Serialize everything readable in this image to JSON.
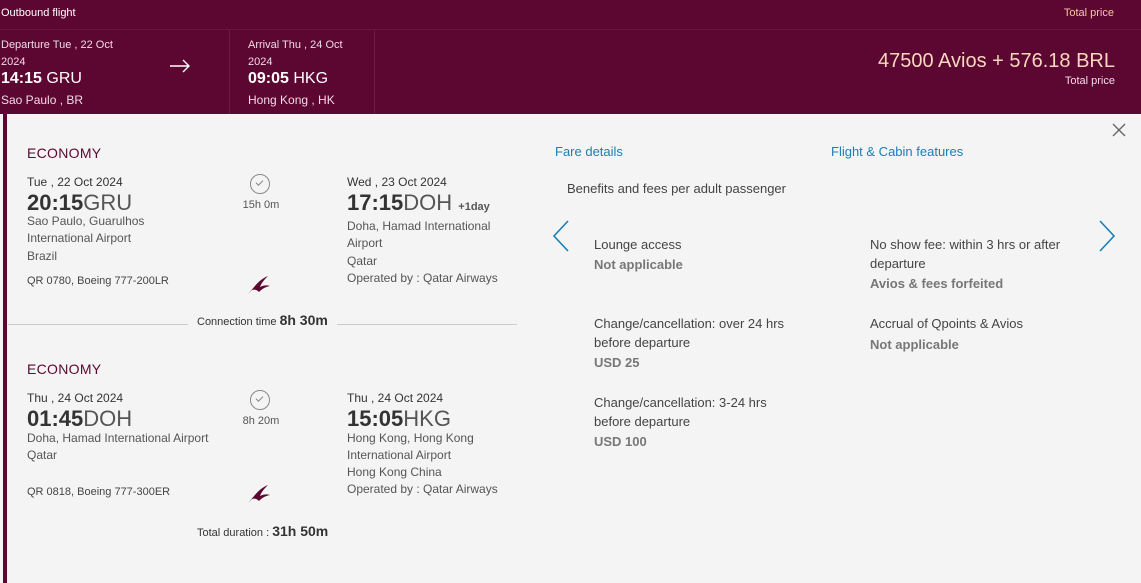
{
  "header": {
    "title": "Outbound flight",
    "total_price_label": "Total price",
    "departure": {
      "label": "Departure Tue , 22 Oct 2024",
      "time": "14:15",
      "code": "GRU",
      "city": "Sao Paulo , BR"
    },
    "arrival": {
      "label": "Arrival Thu , 24 Oct 2024",
      "time": "09:05",
      "code": "HKG",
      "city": "Hong Kong , HK"
    },
    "price": "47500 Avios + 576.18 BRL",
    "price_sub": "Total price",
    "arrow_icon": "arrow-right-icon"
  },
  "segments": [
    {
      "cabin": "ECONOMY",
      "dep_date": "Tue , 22 Oct 2024",
      "dep_time": "20:15",
      "dep_code": "GRU",
      "dep_airport": "Sao Paulo, Guarulhos International Airport",
      "dep_country": "Brazil",
      "duration": "15h 0m",
      "arr_date": "Wed , 23 Oct 2024",
      "arr_time": "17:15",
      "arr_code": "DOH",
      "arr_plus": "+1day",
      "arr_airport": "Doha, Hamad International Airport",
      "arr_country": "Qatar",
      "operated": "Operated by : Qatar Airways",
      "flight": "QR 0780, Boeing 777-200LR"
    },
    {
      "cabin": "ECONOMY",
      "dep_date": "Thu , 24 Oct 2024",
      "dep_time": "01:45",
      "dep_code": "DOH",
      "dep_airport": "Doha, Hamad International Airport",
      "dep_country": "Qatar",
      "duration": "8h 20m",
      "arr_date": "Thu , 24 Oct 2024",
      "arr_time": "15:05",
      "arr_code": "HKG",
      "arr_airport": "Hong Kong, Hong Kong International Airport",
      "arr_country": "Hong Kong China",
      "operated": "Operated by : Qatar Airways",
      "flight": "QR 0818, Boeing 777-300ER"
    }
  ],
  "connection": {
    "label": "Connection time",
    "value": "8h 30m"
  },
  "total_duration": {
    "label": "Total duration :",
    "value": "31h 50m"
  },
  "fare": {
    "tab_fare_details": "Fare details",
    "tab_flight_cabin": "Flight & Cabin features",
    "benefits_title": "Benefits and fees per adult passenger",
    "items": [
      {
        "label": "Lounge access",
        "value": "Not applicable"
      },
      {
        "label": "No show fee: within 3 hrs or after departure",
        "value": "Avios & fees forfeited"
      },
      {
        "label": "Change/cancellation: over 24 hrs before departure",
        "value": "USD 25"
      },
      {
        "label": "Accrual of Qpoints & Avios",
        "value": "Not applicable"
      },
      {
        "label": "Change/cancellation: 3-24 hrs before departure",
        "value": "USD 100"
      }
    ]
  },
  "colors": {
    "brand": "#5c0632",
    "link": "#1a7fb3",
    "panel": "#f4f4f4"
  }
}
